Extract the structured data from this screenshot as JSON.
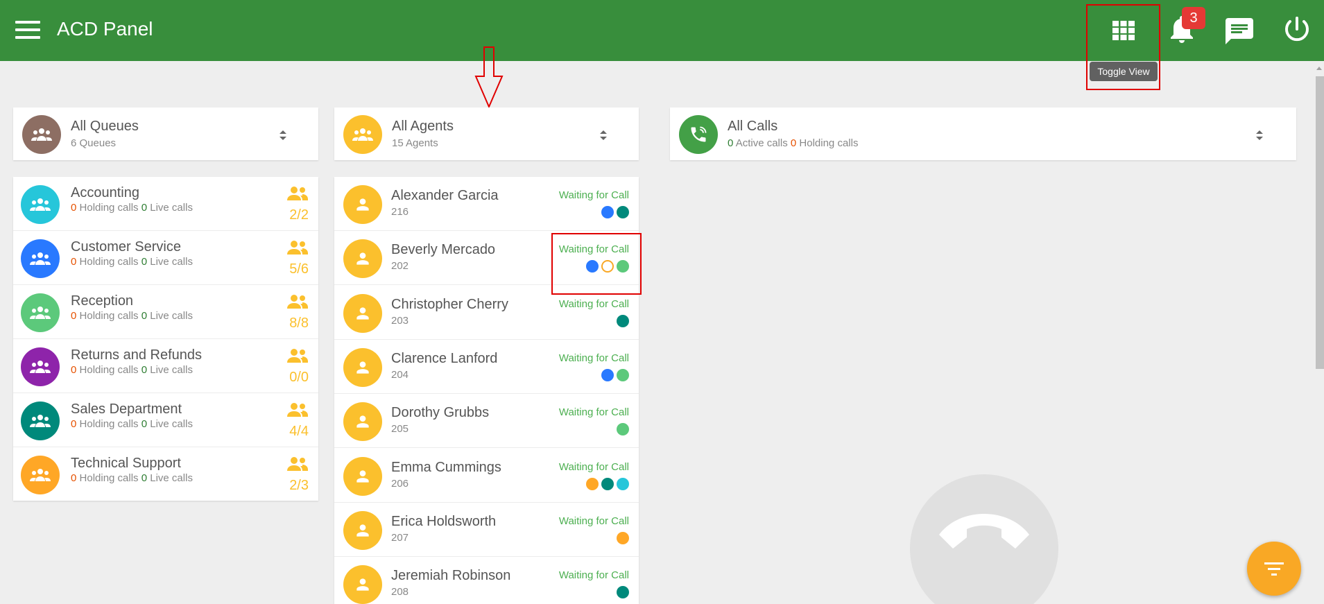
{
  "app": {
    "title": "ACD Panel"
  },
  "header": {
    "notification_count": "3",
    "tooltip": "Toggle View"
  },
  "queues_header": {
    "title": "All Queues",
    "subtitle": "6 Queues"
  },
  "agents_header": {
    "title": "All Agents",
    "subtitle": "15 Agents"
  },
  "calls_header": {
    "title": "All Calls",
    "active_count": "0",
    "active_label": "Active calls",
    "holding_count": "0",
    "holding_label": "Holding calls"
  },
  "queues": [
    {
      "name": "Accounting",
      "holding": "0",
      "holding_label": "Holding calls",
      "live": "0",
      "live_label": "Live calls",
      "ratio": "2/2",
      "color": "#26c6da"
    },
    {
      "name": "Customer Service",
      "holding": "0",
      "holding_label": "Holding calls",
      "live": "0",
      "live_label": "Live calls",
      "ratio": "5/6",
      "color": "#2979ff"
    },
    {
      "name": "Reception",
      "holding": "0",
      "holding_label": "Holding calls",
      "live": "0",
      "live_label": "Live calls",
      "ratio": "8/8",
      "color": "#5cc97b"
    },
    {
      "name": "Returns and Refunds",
      "holding": "0",
      "holding_label": "Holding calls",
      "live": "0",
      "live_label": "Live calls",
      "ratio": "0/0",
      "color": "#8e24aa"
    },
    {
      "name": "Sales Department",
      "holding": "0",
      "holding_label": "Holding calls",
      "live": "0",
      "live_label": "Live calls",
      "ratio": "4/4",
      "color": "#00897b"
    },
    {
      "name": "Technical Support",
      "holding": "0",
      "holding_label": "Holding calls",
      "live": "0",
      "live_label": "Live calls",
      "ratio": "2/3",
      "color": "#ffa726"
    }
  ],
  "agents": [
    {
      "name": "Alexander Garcia",
      "ext": "216",
      "status": "Waiting for Call",
      "dots": [
        "#2979ff",
        "#00897b"
      ]
    },
    {
      "name": "Beverly Mercado",
      "ext": "202",
      "status": "Waiting for Call",
      "dots": [
        "#2979ff",
        "outline",
        "#5cc97b"
      ]
    },
    {
      "name": "Christopher Cherry",
      "ext": "203",
      "status": "Waiting for Call",
      "dots": [
        "#00897b"
      ]
    },
    {
      "name": "Clarence Lanford",
      "ext": "204",
      "status": "Waiting for Call",
      "dots": [
        "#2979ff",
        "#5cc97b"
      ]
    },
    {
      "name": "Dorothy Grubbs",
      "ext": "205",
      "status": "Waiting for Call",
      "dots": [
        "#5cc97b"
      ]
    },
    {
      "name": "Emma Cummings",
      "ext": "206",
      "status": "Waiting for Call",
      "dots": [
        "#ffa726",
        "#00897b",
        "#26c6da"
      ]
    },
    {
      "name": "Erica Holdsworth",
      "ext": "207",
      "status": "Waiting for Call",
      "dots": [
        "#ffa726"
      ]
    },
    {
      "name": "Jeremiah Robinson",
      "ext": "208",
      "status": "Waiting for Call",
      "dots": [
        "#00897b"
      ]
    }
  ],
  "colors": {
    "topbar": "#388e3c",
    "queues_avatar": "#8d6e63",
    "agent_avatar": "#fbc02d",
    "calls_avatar": "#43a047",
    "status_text": "#4caf50",
    "highlight": "#e00000"
  },
  "icons": {
    "menu": "hamburger-icon",
    "toggle_view": "grid-icon",
    "notifications": "bell-icon",
    "messages": "chat-icon",
    "power": "power-icon",
    "filter": "filter-icon"
  }
}
